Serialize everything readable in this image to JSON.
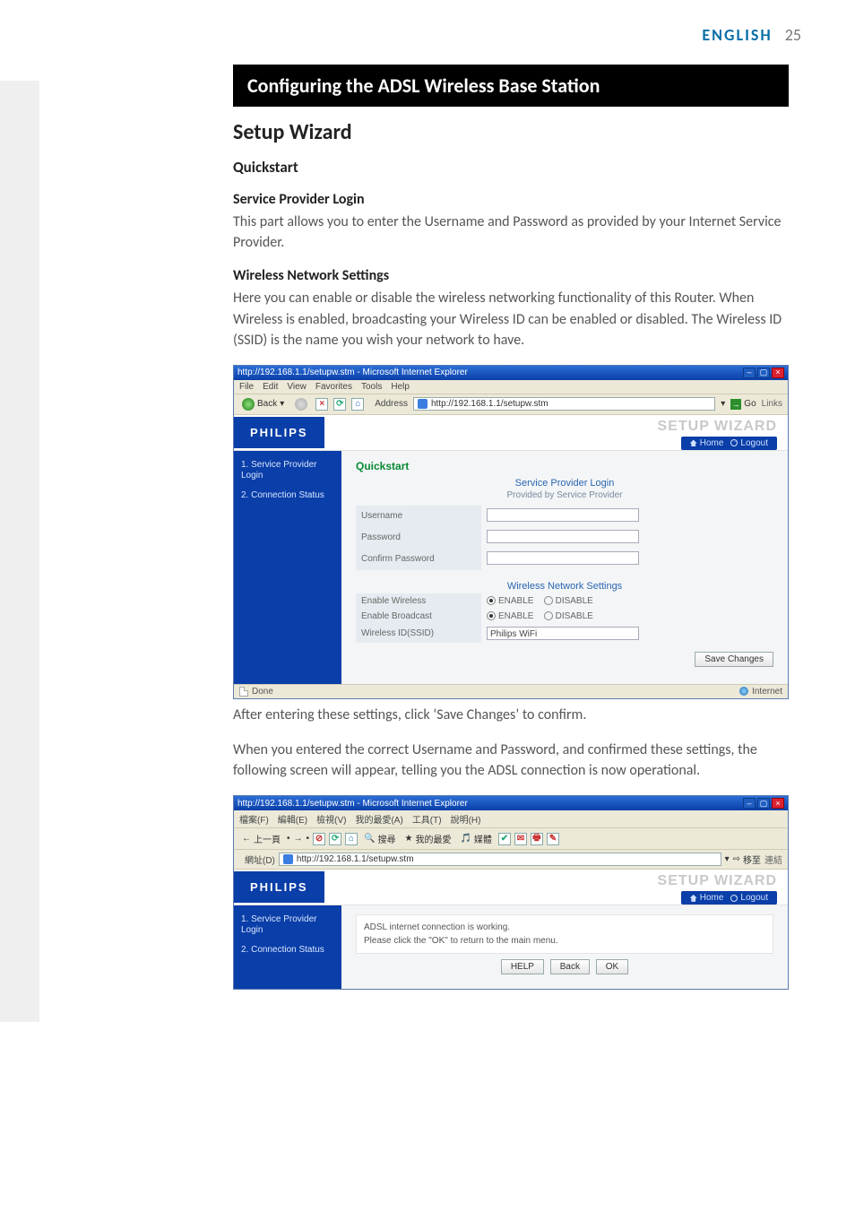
{
  "header": {
    "language": "ENGLISH",
    "page_number": "25"
  },
  "title_bar": "Configuring the ADSL Wireless Base Station",
  "h2": "Setup Wizard",
  "quickstart_heading": "Quickstart",
  "spl": {
    "heading": "Service Provider Login",
    "body": "This part allows you to enter the Username and Password as provided by your Internet Service Provider."
  },
  "wns": {
    "heading": "Wireless Network Settings",
    "body": "Here you can enable or disable the wireless networking functionality of this Router. When Wireless is enabled, broadcasting your Wireless ID can be enabled or disabled. The Wireless ID (SSID) is the name you wish your network to have."
  },
  "caption_after_shot1": "After entering these settings, click ‘Save Changes’ to confirm.",
  "para_after": "When you entered the correct Username and Password, and confirmed these settings, the following screen will appear, telling you the ADSL connection is now operational.",
  "ie": {
    "window_title": "http://192.168.1.1/setupw.stm - Microsoft Internet Explorer",
    "menu": [
      "File",
      "Edit",
      "View",
      "Favorites",
      "Tools",
      "Help"
    ],
    "back": "Back",
    "address_label": "Address",
    "address_value": "http://192.168.1.1/setupw.stm",
    "go": "Go",
    "links": "Links",
    "status_done": "Done",
    "status_zone": "Internet"
  },
  "router": {
    "brand": "PHILIPS",
    "wizard_title": "SETUP WIZARD",
    "home": "Home",
    "logout": "Logout",
    "sidebar": {
      "item1": "1. Service Provider Login",
      "item2": "2. Connection Status"
    },
    "quickstart": "Quickstart",
    "spl_title": "Service Provider Login",
    "spl_sub": "Provided by Service Provider",
    "fields": {
      "username": "Username",
      "password": "Password",
      "confirm": "Confirm Password"
    },
    "wns_title": "Wireless Network Settings",
    "rows": {
      "enable_wireless": "Enable Wireless",
      "enable_broadcast": "Enable Broadcast",
      "ssid_label": "Wireless ID(SSID)"
    },
    "options": {
      "enable": "ENABLE",
      "disable": "DISABLE"
    },
    "ssid_value": "Philips WiFi",
    "save_btn": "Save Changes"
  },
  "ie2": {
    "window_title": "http://192.168.1.1/setupw.stm - Microsoft Internet Explorer",
    "menu": [
      "檔案(F)",
      "編輯(E)",
      "檢視(V)",
      "我的最愛(A)",
      "工具(T)",
      "說明(H)"
    ],
    "back": "上一頁",
    "search": "搜尋",
    "fav": "我的最愛",
    "media": "媒體",
    "address_label": "網址(D)",
    "address_value": "http://192.168.1.1/setupw.stm",
    "go": "移至",
    "links": "連結"
  },
  "router2": {
    "msg1": "ADSL internet connection is working.",
    "msg2": "Please click the \"OK\" to return to the main menu.",
    "help": "HELP",
    "back": "Back",
    "ok": "OK"
  }
}
